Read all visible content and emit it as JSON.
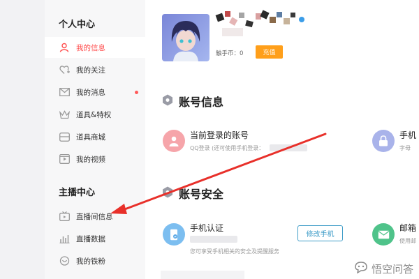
{
  "sidebar": {
    "personal_center": "个人中心",
    "streamer_center": "主播中心",
    "items": [
      {
        "label": "我的信息",
        "icon": "user-icon"
      },
      {
        "label": "我的关注",
        "icon": "heart-plus-icon"
      },
      {
        "label": "我的消息",
        "icon": "mail-icon"
      },
      {
        "label": "道具&特权",
        "icon": "crown-icon"
      },
      {
        "label": "道具商城",
        "icon": "store-icon"
      },
      {
        "label": "我的视频",
        "icon": "video-icon"
      }
    ],
    "streamer_items": [
      {
        "label": "直播间信息",
        "icon": "tv-icon"
      },
      {
        "label": "直播数据",
        "icon": "bar-chart-icon"
      },
      {
        "label": "我的铁粉",
        "icon": "fan-icon"
      }
    ]
  },
  "profile": {
    "coins_label": "触手币：0",
    "charge_label": "充值"
  },
  "account_info": {
    "title": "账号信息",
    "current_account": "当前登录的账号",
    "current_account_sub": "QQ登录 (还可使用手机登录：",
    "phone_partial": "手机",
    "phone_partial_sub": "字母"
  },
  "account_security": {
    "title": "账号安全",
    "phone_auth": "手机认证",
    "phone_auth_sub": "您可享受手机相关的安全及提醒服务",
    "modify_phone": "修改手机",
    "email_partial": "邮箱",
    "email_partial_sub": "使用邮"
  },
  "watermark": "悟空问答",
  "colors": {
    "accent": "#ff4e4e",
    "charge": "#ff9f1a",
    "outline": "#3c9bc7",
    "arrow": "#e8302a"
  }
}
